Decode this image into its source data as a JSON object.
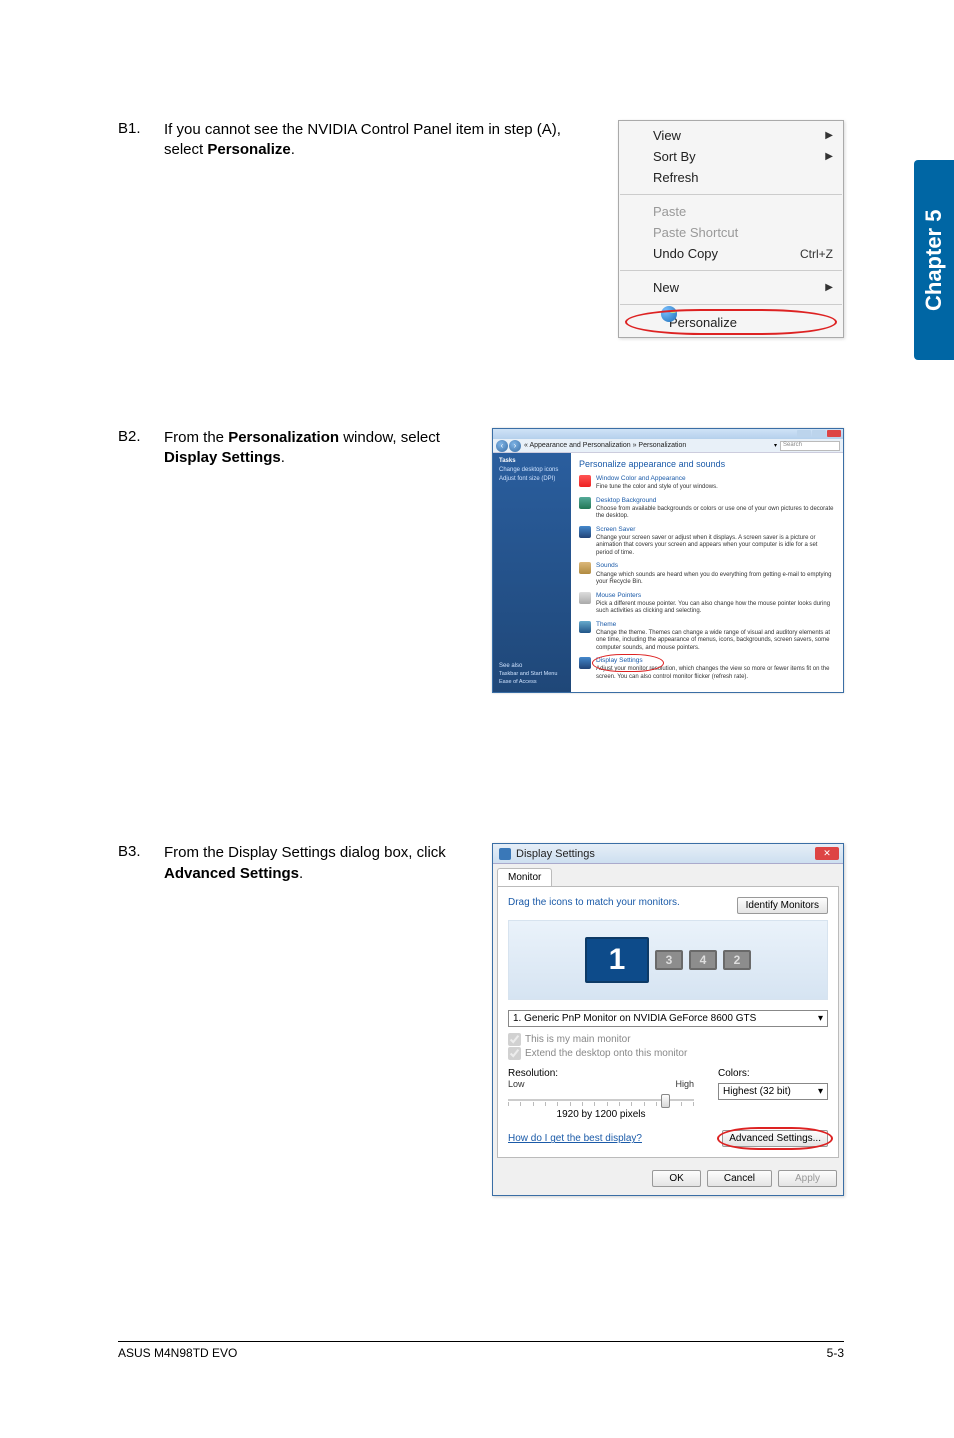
{
  "chapter_tab": "Chapter 5",
  "steps": {
    "b1": {
      "num": "B1.",
      "text_pre": "If you cannot see the NVIDIA Control Panel item in step (A), select ",
      "text_bold": "Personalize",
      "text_post": "."
    },
    "b2": {
      "num": "B2.",
      "text_pre": "From the ",
      "text_bold1": "Personalization",
      "text_mid": " window, select ",
      "text_bold2": "Display Settings",
      "text_post": "."
    },
    "b3": {
      "num": "B3.",
      "text_pre": "From the Display Settings dialog box, click ",
      "text_bold": "Advanced Settings",
      "text_post": "."
    }
  },
  "ctx_menu": {
    "view": "View",
    "sort_by": "Sort By",
    "refresh": "Refresh",
    "paste": "Paste",
    "paste_shortcut": "Paste Shortcut",
    "undo_copy": "Undo Copy",
    "undo_copy_shortcut": "Ctrl+Z",
    "new": "New",
    "personalize": "Personalize"
  },
  "pers": {
    "path": "« Appearance and Personalization » Personalization",
    "search_placeholder": "Search",
    "tasks_label": "Tasks",
    "side_links": {
      "change_icons": "Change desktop icons",
      "adjust_font": "Adjust font size (DPI)"
    },
    "see_also": "See also",
    "side_bottom": {
      "taskbar": "Taskbar and Start Menu",
      "ease": "Ease of Access"
    },
    "heading": "Personalize appearance and sounds",
    "items": {
      "win_color": {
        "title": "Window Color and Appearance",
        "desc": "Fine tune the color and style of your windows."
      },
      "bg": {
        "title": "Desktop Background",
        "desc": "Choose from available backgrounds or colors or use one of your own pictures to decorate the desktop."
      },
      "ss": {
        "title": "Screen Saver",
        "desc": "Change your screen saver or adjust when it displays. A screen saver is a picture or animation that covers your screen and appears when your computer is idle for a set period of time."
      },
      "snd": {
        "title": "Sounds",
        "desc": "Change which sounds are heard when you do everything from getting e-mail to emptying your Recycle Bin."
      },
      "mp": {
        "title": "Mouse Pointers",
        "desc": "Pick a different mouse pointer. You can also change how the mouse pointer looks during such activities as clicking and selecting."
      },
      "th": {
        "title": "Theme",
        "desc": "Change the theme. Themes can change a wide range of visual and auditory elements at one time, including the appearance of menus, icons, backgrounds, screen savers, some computer sounds, and mouse pointers."
      },
      "ds": {
        "title": "Display Settings",
        "desc": "Adjust your monitor resolution, which changes the view so more or fewer items fit on the screen. You can also control monitor flicker (refresh rate)."
      }
    }
  },
  "ds": {
    "title": "Display Settings",
    "tab": "Monitor",
    "drag_text": "Drag the icons to match your monitors.",
    "identify": "Identify Monitors",
    "monitors": {
      "m1": "1",
      "m3": "3",
      "m4": "4",
      "m2": "2"
    },
    "dropdown": "1. Generic PnP Monitor on NVIDIA GeForce 8600 GTS",
    "chk_main": "This is my main monitor",
    "chk_extend": "Extend the desktop onto this monitor",
    "res_label": "Resolution:",
    "low": "Low",
    "high": "High",
    "res_value": "1920 by 1200 pixels",
    "colors_label": "Colors:",
    "colors_value": "Highest (32 bit)",
    "help": "How do I get the best display?",
    "adv": "Advanced Settings...",
    "ok": "OK",
    "cancel": "Cancel",
    "apply": "Apply"
  },
  "footer": {
    "left": "ASUS M4N98TD EVO",
    "right": "5-3"
  }
}
